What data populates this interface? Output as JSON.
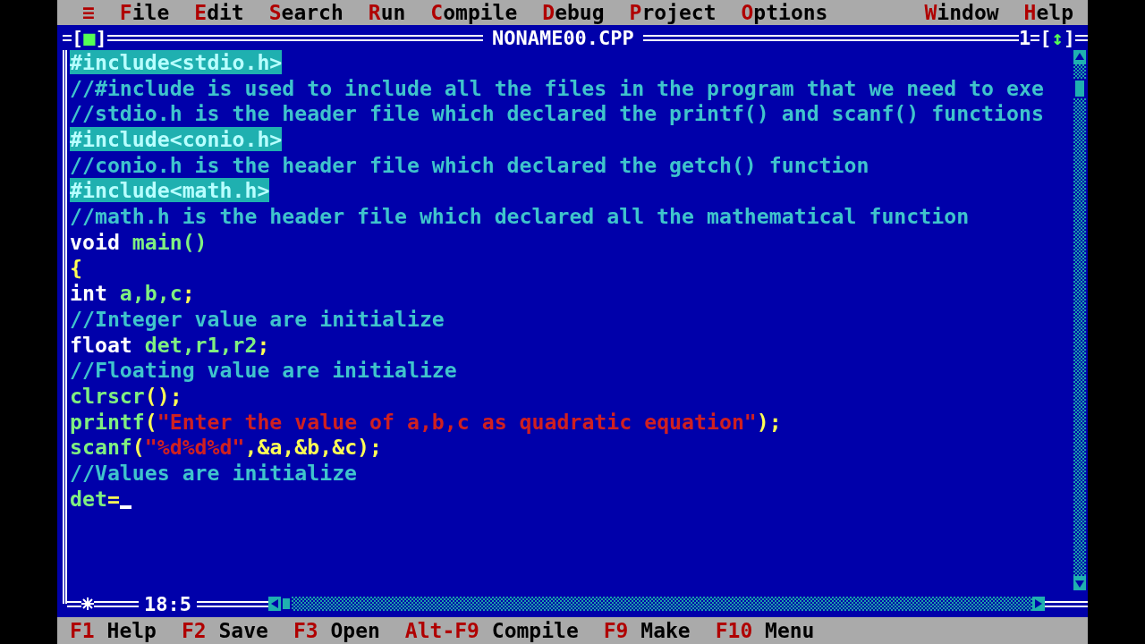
{
  "menu": {
    "left": [
      {
        "label": "≡"
      },
      {
        "label": "File"
      },
      {
        "label": "Edit"
      },
      {
        "label": "Search"
      },
      {
        "label": "Run"
      },
      {
        "label": "Compile"
      },
      {
        "label": "Debug"
      },
      {
        "label": "Project"
      },
      {
        "label": "Options"
      }
    ],
    "right": [
      {
        "label": "Window"
      },
      {
        "label": "Help"
      }
    ]
  },
  "window": {
    "title": "NONAME00.CPP",
    "close_box": "[■]",
    "number": "1",
    "zoom_box": "[↕]"
  },
  "editor": {
    "lines": [
      [
        {
          "kind": "preproc",
          "text": "#include<stdio.h>"
        }
      ],
      [
        {
          "kind": "comment",
          "text": "//#include is used to include all the files in the program that we need to exe"
        }
      ],
      [
        {
          "kind": "comment",
          "text": "//stdio.h is the header file which declared the printf() and scanf() functions"
        }
      ],
      [
        {
          "kind": "preproc",
          "text": "#include<conio.h>"
        }
      ],
      [
        {
          "kind": "comment",
          "text": "//conio.h is the header file which declared the getch() function"
        }
      ],
      [
        {
          "kind": "preproc",
          "text": "#include<math.h>"
        }
      ],
      [
        {
          "kind": "comment",
          "text": "//math.h is the header file which declared all the mathematical function"
        }
      ],
      [
        {
          "kind": "keyword",
          "text": "void "
        },
        {
          "kind": "ident",
          "text": "main()"
        }
      ],
      [
        {
          "kind": "punct",
          "text": "{"
        }
      ],
      [
        {
          "kind": "keyword",
          "text": "int "
        },
        {
          "kind": "ident",
          "text": "a,b,c"
        },
        {
          "kind": "punct",
          "text": ";"
        }
      ],
      [
        {
          "kind": "comment",
          "text": "//Integer value are initialize"
        }
      ],
      [
        {
          "kind": "keyword",
          "text": "float "
        },
        {
          "kind": "ident",
          "text": "det,r1,r2"
        },
        {
          "kind": "punct",
          "text": ";"
        }
      ],
      [
        {
          "kind": "comment",
          "text": "//Floating value are initialize"
        }
      ],
      [
        {
          "kind": "ident",
          "text": "clrscr"
        },
        {
          "kind": "punct",
          "text": "();"
        }
      ],
      [
        {
          "kind": "ident",
          "text": "printf"
        },
        {
          "kind": "punct",
          "text": "("
        },
        {
          "kind": "string",
          "text": "\"Enter the value of a,b,c as quadratic equation\""
        },
        {
          "kind": "punct",
          "text": ");"
        }
      ],
      [
        {
          "kind": "ident",
          "text": "scanf"
        },
        {
          "kind": "punct",
          "text": "("
        },
        {
          "kind": "string",
          "text": "\"%d%d%d\""
        },
        {
          "kind": "punct",
          "text": ",&a,&b,&c);"
        }
      ],
      [
        {
          "kind": "comment",
          "text": "//Values are initialize"
        }
      ],
      [
        {
          "kind": "ident",
          "text": "det"
        },
        {
          "kind": "punct",
          "text": "="
        },
        {
          "kind": "cursor"
        }
      ]
    ],
    "modified": true,
    "position": "18:5"
  },
  "status_bar": [
    {
      "key": "F1",
      "label": "Help"
    },
    {
      "key": "F2",
      "label": "Save"
    },
    {
      "key": "F3",
      "label": "Open"
    },
    {
      "key": "Alt-F9",
      "label": "Compile"
    },
    {
      "key": "F9",
      "label": "Make"
    },
    {
      "key": "F10",
      "label": "Menu"
    }
  ]
}
